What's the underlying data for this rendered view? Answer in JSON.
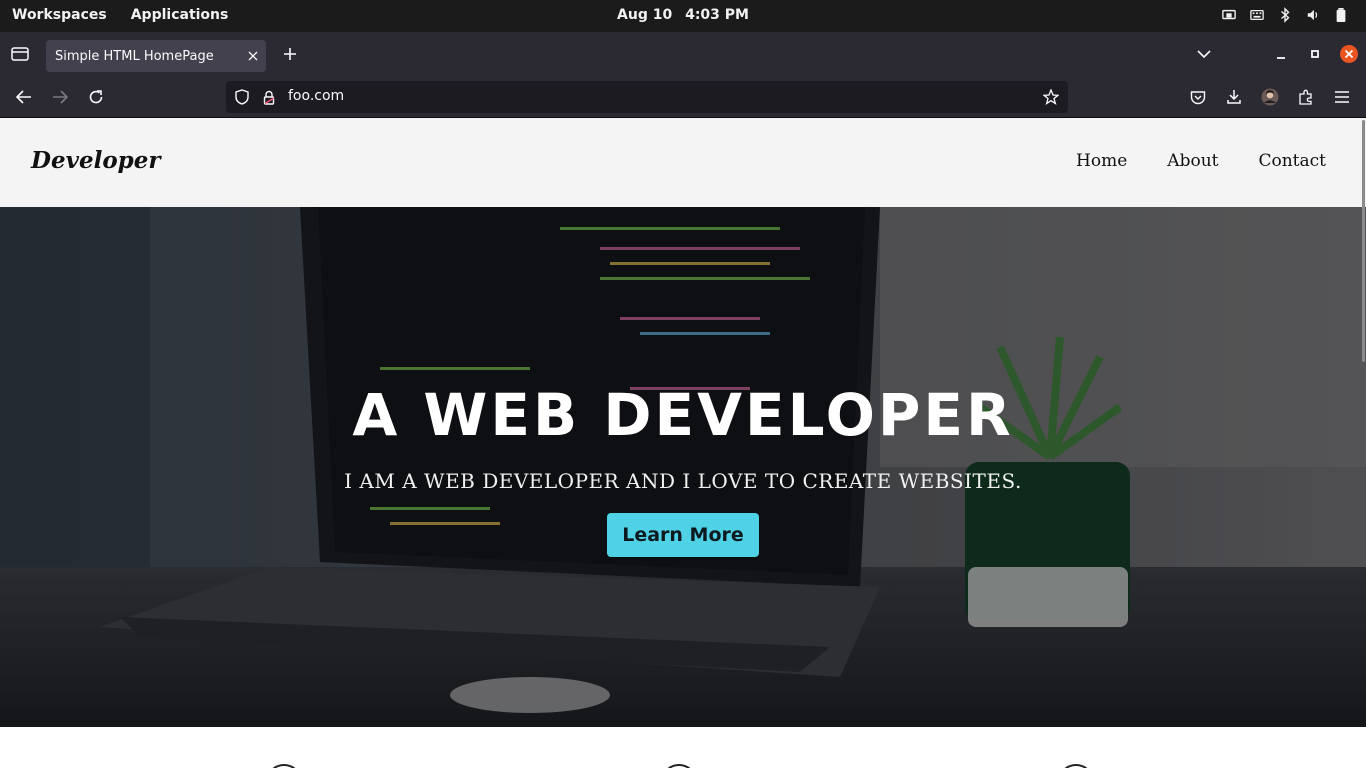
{
  "desktop": {
    "workspaces_label": "Workspaces",
    "applications_label": "Applications",
    "date": "Aug 10",
    "time": "4:03 PM",
    "tray_icons": [
      "screen-share-icon",
      "keyboard-icon",
      "bluetooth-icon",
      "volume-icon",
      "battery-icon"
    ]
  },
  "browser": {
    "tab_title": "Simple HTML HomePage",
    "url": "foo.com",
    "accent_close": "#e95420"
  },
  "site": {
    "logo": "Developer",
    "nav": [
      {
        "label": "Home"
      },
      {
        "label": "About"
      },
      {
        "label": "Contact"
      }
    ],
    "hero": {
      "title": "A WEB DEVELOPER",
      "subtitle": "I AM A WEB DEVELOPER AND I LOVE TO CREATE WEBSITES.",
      "button_label": "Learn More",
      "button_color": "#4fd1e6"
    }
  }
}
